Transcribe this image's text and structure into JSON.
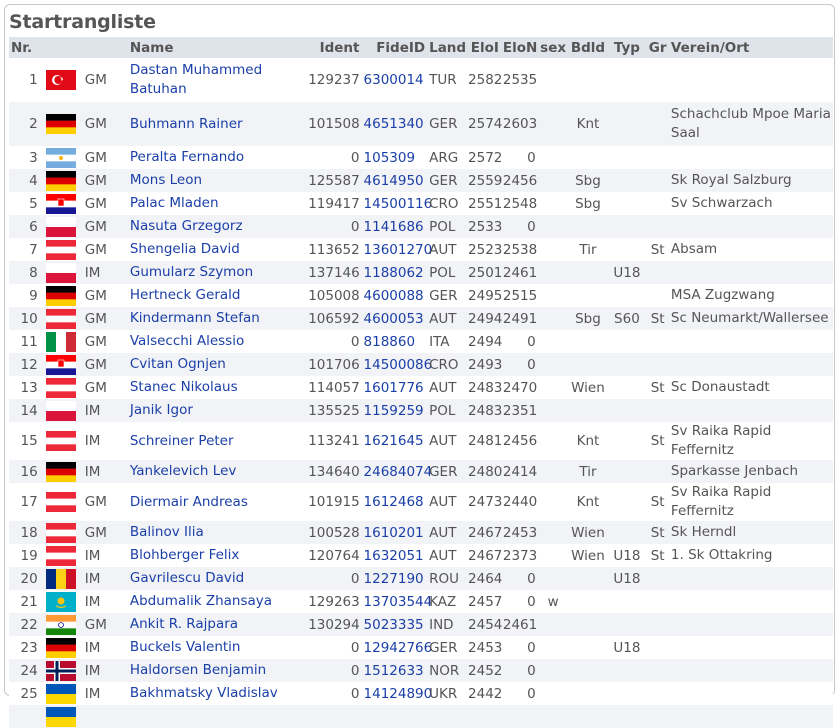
{
  "page": {
    "title": "Startrangliste"
  },
  "columns": {
    "nr": "Nr.",
    "name": "Name",
    "ident": "Ident",
    "fideid": "FideID",
    "land": "Land",
    "elol": "EloI",
    "elon": "EloN",
    "sex": "sex",
    "bdld": "Bdld",
    "typ": "Typ",
    "gr": "Gr",
    "verein": "Verein/Ort"
  },
  "flag_colors": {
    "TUR": [
      "#e30a17",
      "#ffffff"
    ],
    "GER": [
      "#000000",
      "#dd0000",
      "#ffce00"
    ],
    "ARG": [
      "#74acdf",
      "#ffffff",
      "#f6b40e"
    ],
    "CRO": [
      "#ff0000",
      "#ffffff",
      "#171796"
    ],
    "POL": [
      "#ffffff",
      "#dc143c"
    ],
    "AUT": [
      "#ed2939",
      "#ffffff"
    ],
    "ITA": [
      "#009246",
      "#ffffff",
      "#ce2b37"
    ],
    "ROU": [
      "#002b7f",
      "#fcd116",
      "#ce1126"
    ],
    "KAZ": [
      "#00afca",
      "#fec50c"
    ],
    "IND": [
      "#ff9933",
      "#ffffff",
      "#138808",
      "#000080"
    ],
    "NOR": [
      "#ba0c2f",
      "#ffffff",
      "#00205b"
    ],
    "UKR": [
      "#0057b7",
      "#ffd700"
    ]
  },
  "rows": [
    {
      "nr": "1",
      "flag": "TUR",
      "flag_icon": "turkey-flag-icon",
      "title": "GM",
      "name": "Dastan Muhammed Batuhan",
      "ident": "129237",
      "fideid": "6300014",
      "land": "TUR",
      "elol": "2582",
      "elon": "2535",
      "sex": "",
      "bdld": "",
      "typ": "",
      "gr": "",
      "verein": "",
      "tall": true
    },
    {
      "nr": "2",
      "flag": "GER",
      "flag_icon": "germany-flag-icon",
      "title": "GM",
      "name": "Buhmann Rainer",
      "ident": "101508",
      "fideid": "4651340",
      "land": "GER",
      "elol": "2574",
      "elon": "2603",
      "sex": "",
      "bdld": "Knt",
      "typ": "",
      "gr": "",
      "verein": "Schachclub Mpoe Maria Saal",
      "tall": true
    },
    {
      "nr": "3",
      "flag": "ARG",
      "flag_icon": "argentina-flag-icon",
      "title": "GM",
      "name": "Peralta Fernando",
      "ident": "0",
      "fideid": "105309",
      "land": "ARG",
      "elol": "2572",
      "elon": "0",
      "sex": "",
      "bdld": "",
      "typ": "",
      "gr": "",
      "verein": ""
    },
    {
      "nr": "4",
      "flag": "GER",
      "flag_icon": "germany-flag-icon",
      "title": "GM",
      "name": "Mons Leon",
      "ident": "125587",
      "fideid": "4614950",
      "land": "GER",
      "elol": "2559",
      "elon": "2456",
      "sex": "",
      "bdld": "Sbg",
      "typ": "",
      "gr": "",
      "verein": "Sk Royal Salzburg"
    },
    {
      "nr": "5",
      "flag": "CRO",
      "flag_icon": "croatia-flag-icon",
      "title": "GM",
      "name": "Palac Mladen",
      "ident": "119417",
      "fideid": "14500116",
      "land": "CRO",
      "elol": "2551",
      "elon": "2548",
      "sex": "",
      "bdld": "Sbg",
      "typ": "",
      "gr": "",
      "verein": "Sv Schwarzach"
    },
    {
      "nr": "6",
      "flag": "POL",
      "flag_icon": "poland-flag-icon",
      "title": "GM",
      "name": "Nasuta Grzegorz",
      "ident": "0",
      "fideid": "1141686",
      "land": "POL",
      "elol": "2533",
      "elon": "0",
      "sex": "",
      "bdld": "",
      "typ": "",
      "gr": "",
      "verein": ""
    },
    {
      "nr": "7",
      "flag": "AUT",
      "flag_icon": "austria-flag-icon",
      "title": "GM",
      "name": "Shengelia David",
      "ident": "113652",
      "fideid": "13601270",
      "land": "AUT",
      "elol": "2523",
      "elon": "2538",
      "sex": "",
      "bdld": "Tir",
      "typ": "",
      "gr": "St",
      "verein": "Absam"
    },
    {
      "nr": "8",
      "flag": "POL",
      "flag_icon": "poland-flag-icon",
      "title": "IM",
      "name": "Gumularz Szymon",
      "ident": "137146",
      "fideid": "1188062",
      "land": "POL",
      "elol": "2501",
      "elon": "2461",
      "sex": "",
      "bdld": "",
      "typ": "U18",
      "gr": "",
      "verein": ""
    },
    {
      "nr": "9",
      "flag": "GER",
      "flag_icon": "germany-flag-icon",
      "title": "GM",
      "name": "Hertneck Gerald",
      "ident": "105008",
      "fideid": "4600088",
      "land": "GER",
      "elol": "2495",
      "elon": "2515",
      "sex": "",
      "bdld": "",
      "typ": "",
      "gr": "",
      "verein": "MSA Zugzwang"
    },
    {
      "nr": "10",
      "flag": "AUT",
      "flag_icon": "austria-flag-icon",
      "title": "GM",
      "name": "Kindermann Stefan",
      "ident": "106592",
      "fideid": "4600053",
      "land": "AUT",
      "elol": "2494",
      "elon": "2491",
      "sex": "",
      "bdld": "Sbg",
      "typ": "S60",
      "gr": "St",
      "verein": "Sc Neumarkt/Wallersee"
    },
    {
      "nr": "11",
      "flag": "ITA",
      "flag_icon": "italy-flag-icon",
      "title": "GM",
      "name": "Valsecchi Alessio",
      "ident": "0",
      "fideid": "818860",
      "land": "ITA",
      "elol": "2494",
      "elon": "0",
      "sex": "",
      "bdld": "",
      "typ": "",
      "gr": "",
      "verein": ""
    },
    {
      "nr": "12",
      "flag": "CRO",
      "flag_icon": "croatia-flag-icon",
      "title": "GM",
      "name": "Cvitan Ognjen",
      "ident": "101706",
      "fideid": "14500086",
      "land": "CRO",
      "elol": "2493",
      "elon": "0",
      "sex": "",
      "bdld": "",
      "typ": "",
      "gr": "",
      "verein": ""
    },
    {
      "nr": "13",
      "flag": "AUT",
      "flag_icon": "austria-flag-icon",
      "title": "GM",
      "name": "Stanec Nikolaus",
      "ident": "114057",
      "fideid": "1601776",
      "land": "AUT",
      "elol": "2483",
      "elon": "2470",
      "sex": "",
      "bdld": "Wien",
      "typ": "",
      "gr": "St",
      "verein": "Sc Donaustadt"
    },
    {
      "nr": "14",
      "flag": "POL",
      "flag_icon": "poland-flag-icon",
      "title": "IM",
      "name": "Janik Igor",
      "ident": "135525",
      "fideid": "1159259",
      "land": "POL",
      "elol": "2483",
      "elon": "2351",
      "sex": "",
      "bdld": "",
      "typ": "",
      "gr": "",
      "verein": ""
    },
    {
      "nr": "15",
      "flag": "AUT",
      "flag_icon": "austria-flag-icon",
      "title": "IM",
      "name": "Schreiner Peter",
      "ident": "113241",
      "fideid": "1621645",
      "land": "AUT",
      "elol": "2481",
      "elon": "2456",
      "sex": "",
      "bdld": "Knt",
      "typ": "",
      "gr": "St",
      "verein": "Sv Raika Rapid Feffernitz"
    },
    {
      "nr": "16",
      "flag": "GER",
      "flag_icon": "germany-flag-icon",
      "title": "IM",
      "name": "Yankelevich Lev",
      "ident": "134640",
      "fideid": "24684074",
      "land": "GER",
      "elol": "2480",
      "elon": "2414",
      "sex": "",
      "bdld": "Tir",
      "typ": "",
      "gr": "",
      "verein": "Sparkasse Jenbach"
    },
    {
      "nr": "17",
      "flag": "AUT",
      "flag_icon": "austria-flag-icon",
      "title": "GM",
      "name": "Diermair Andreas",
      "ident": "101915",
      "fideid": "1612468",
      "land": "AUT",
      "elol": "2473",
      "elon": "2440",
      "sex": "",
      "bdld": "Knt",
      "typ": "",
      "gr": "St",
      "verein": "Sv Raika Rapid Feffernitz"
    },
    {
      "nr": "18",
      "flag": "AUT",
      "flag_icon": "austria-flag-icon",
      "title": "GM",
      "name": "Balinov Ilia",
      "ident": "100528",
      "fideid": "1610201",
      "land": "AUT",
      "elol": "2467",
      "elon": "2453",
      "sex": "",
      "bdld": "Wien",
      "typ": "",
      "gr": "St",
      "verein": "Sk Herndl"
    },
    {
      "nr": "19",
      "flag": "AUT",
      "flag_icon": "austria-flag-icon",
      "title": "IM",
      "name": "Blohberger Felix",
      "ident": "120764",
      "fideid": "1632051",
      "land": "AUT",
      "elol": "2467",
      "elon": "2373",
      "sex": "",
      "bdld": "Wien",
      "typ": "U18",
      "gr": "St",
      "verein": "1. Sk Ottakring"
    },
    {
      "nr": "20",
      "flag": "ROU",
      "flag_icon": "romania-flag-icon",
      "title": "IM",
      "name": "Gavrilescu David",
      "ident": "0",
      "fideid": "1227190",
      "land": "ROU",
      "elol": "2464",
      "elon": "0",
      "sex": "",
      "bdld": "",
      "typ": "U18",
      "gr": "",
      "verein": ""
    },
    {
      "nr": "21",
      "flag": "KAZ",
      "flag_icon": "kazakhstan-flag-icon",
      "title": "IM",
      "name": "Abdumalik Zhansaya",
      "ident": "129263",
      "fideid": "13703544",
      "land": "KAZ",
      "elol": "2457",
      "elon": "0",
      "sex": "w",
      "bdld": "",
      "typ": "",
      "gr": "",
      "verein": ""
    },
    {
      "nr": "22",
      "flag": "IND",
      "flag_icon": "india-flag-icon",
      "title": "GM",
      "name": "Ankit R. Rajpara",
      "ident": "130294",
      "fideid": "5023335",
      "land": "IND",
      "elol": "2454",
      "elon": "2461",
      "sex": "",
      "bdld": "",
      "typ": "",
      "gr": "",
      "verein": ""
    },
    {
      "nr": "23",
      "flag": "GER",
      "flag_icon": "germany-flag-icon",
      "title": "IM",
      "name": "Buckels Valentin",
      "ident": "0",
      "fideid": "12942766",
      "land": "GER",
      "elol": "2453",
      "elon": "0",
      "sex": "",
      "bdld": "",
      "typ": "U18",
      "gr": "",
      "verein": ""
    },
    {
      "nr": "24",
      "flag": "NOR",
      "flag_icon": "norway-flag-icon",
      "title": "IM",
      "name": "Haldorsen Benjamin",
      "ident": "0",
      "fideid": "1512633",
      "land": "NOR",
      "elol": "2452",
      "elon": "0",
      "sex": "",
      "bdld": "",
      "typ": "",
      "gr": "",
      "verein": ""
    },
    {
      "nr": "25",
      "flag": "UKR",
      "flag_icon": "ukraine-flag-icon",
      "title": "IM",
      "name": "Bakhmatsky Vladislav",
      "ident": "0",
      "fideid": "14124890",
      "land": "UKR",
      "elol": "2442",
      "elon": "0",
      "sex": "",
      "bdld": "",
      "typ": "",
      "gr": "",
      "verein": ""
    },
    {
      "nr": "",
      "flag": "UKR",
      "flag_icon": "ukraine-flag-icon",
      "title": "",
      "name": "",
      "ident": "",
      "fideid": "",
      "land": "",
      "elol": "",
      "elon": "",
      "sex": "",
      "bdld": "",
      "typ": "",
      "gr": "",
      "verein": ""
    }
  ]
}
